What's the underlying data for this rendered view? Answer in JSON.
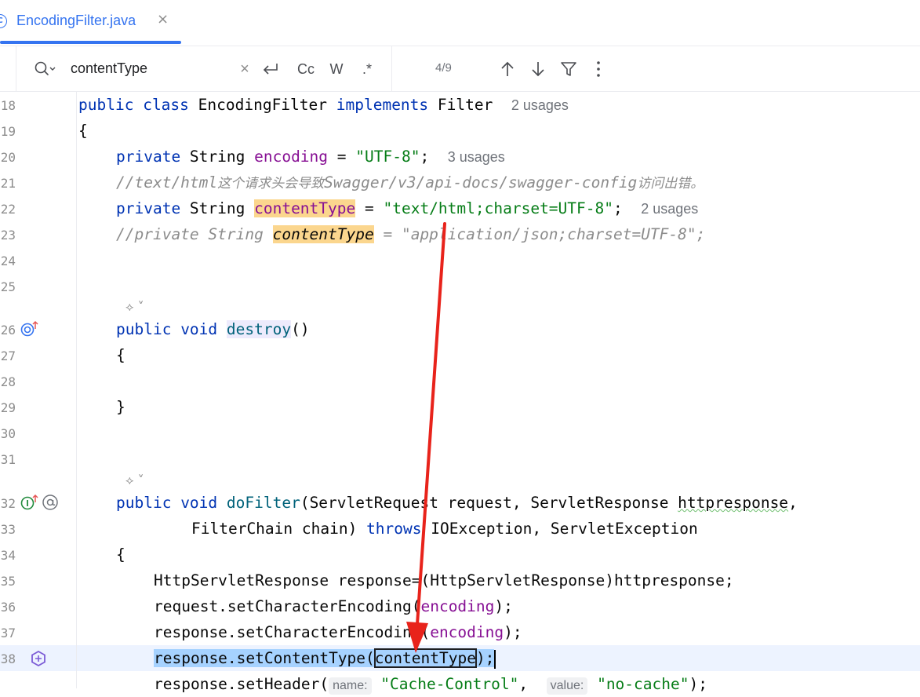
{
  "tab": {
    "label": "EncodingFilter.java",
    "close": "×",
    "icon": "C"
  },
  "find": {
    "query": "contentType",
    "clear": "×",
    "regex_btn": ".*",
    "case_btn": "Cc",
    "word_btn": "W",
    "count": "4/9"
  },
  "gutter": {
    "line_numbers": [
      "18",
      "19",
      "20",
      "21",
      "22",
      "23",
      "24",
      "25",
      "26",
      "27",
      "28",
      "29",
      "30",
      "31",
      "32",
      "33",
      "34",
      "35",
      "36",
      "37",
      "38",
      ""
    ]
  },
  "code": {
    "l18": {
      "kw1": "public",
      "kw2": "class",
      "name": " EncodingFilter ",
      "kw3": "implements",
      "rest": " Filter",
      "hint": "2 usages"
    },
    "l19": "{",
    "l20": {
      "kw": "private",
      "type": " String ",
      "field": "encoding",
      "eq": " = ",
      "str": "\"UTF-8\"",
      "semi": ";",
      "hint": "3 usages"
    },
    "l21": {
      "pre": "//text/html",
      "cn1": "这个请求头会导致",
      "mid": "Swagger/v3/api-docs/swagger-config",
      "cn2": "访问出错。"
    },
    "l22": {
      "kw": "private",
      "type": " String ",
      "field": "contentType",
      "eq": " = ",
      "str": "\"text/html;charset=UTF-8\"",
      "semi": ";",
      "hint": "2 usages"
    },
    "l23": {
      "pre": "//private String ",
      "match": "contentType",
      "post": " = \"application/json;charset=UTF-8\";"
    },
    "l26": {
      "kw1": "public",
      "kw2": " void ",
      "fn": "destroy",
      "rest": "()"
    },
    "l27": "{",
    "l29": "}",
    "l32": {
      "kw1": "public",
      "kw2": " void ",
      "fn": "doFilter",
      "rest": "(ServletRequest request, ServletResponse ",
      "wavy": "httpresponse",
      ",": ","
    },
    "l33": {
      "pre": "FilterChain chain) ",
      "kw": "throws",
      "rest": " IOException, ServletException"
    },
    "l34": "{",
    "l35": "HttpServletResponse response=(HttpServletResponse)httpresponse;",
    "l36": {
      "pre": "request.setCharacterEncoding(",
      "fld": "encoding",
      "post": ");"
    },
    "l37": {
      "pre": "response.setCharacterEncoding(",
      "fld": "encoding",
      "post": ");"
    },
    "l38": {
      "a": "response.",
      "b": "setContentType",
      "c": "(",
      "d": "contentType",
      "e": ");"
    },
    "l39": {
      "pre": "response.setHeader(",
      "h1": "name:",
      "s1": "\"Cache-Control\"",
      "mid": ", ",
      "h2": "value:",
      "s2": "\"no-cache\"",
      "post": ");"
    }
  }
}
